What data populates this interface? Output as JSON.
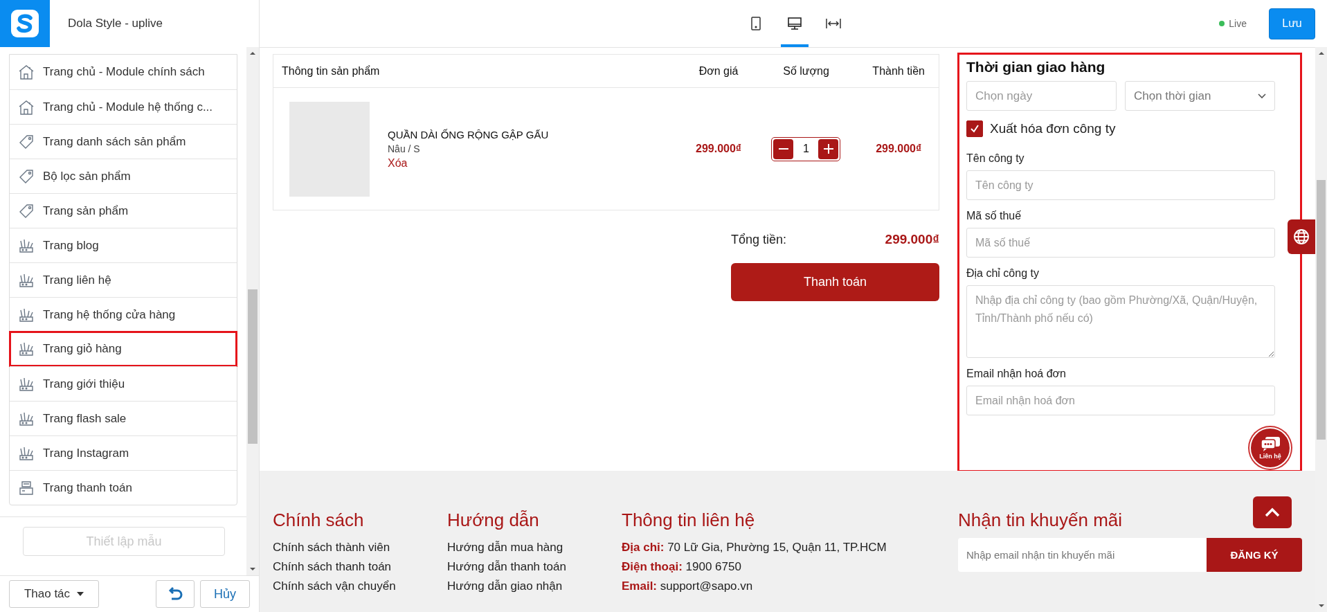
{
  "app": {
    "title": "Dola Style - uplive"
  },
  "toolbar": {
    "views": [
      {
        "kind": "mobile",
        "selected": false
      },
      {
        "kind": "desktop",
        "selected": true
      },
      {
        "kind": "fullwidth",
        "selected": false
      }
    ],
    "status": "Live",
    "save": "Lưu"
  },
  "sidebar": {
    "items": [
      {
        "kind": "home",
        "label": "Trang chủ - Module chính sách",
        "selected": false
      },
      {
        "kind": "home",
        "label": "Trang chủ - Module hệ thống c...",
        "selected": false
      },
      {
        "kind": "tag",
        "label": "Trang danh sách sản phẩm",
        "selected": false
      },
      {
        "kind": "tag",
        "label": "Bộ lọc sản phẩm",
        "selected": false
      },
      {
        "kind": "tag",
        "label": "Trang sản phẩm",
        "selected": false
      },
      {
        "kind": "tools",
        "label": "Trang blog",
        "selected": false
      },
      {
        "kind": "tools",
        "label": "Trang liên hệ",
        "selected": false
      },
      {
        "kind": "tools",
        "label": "Trang hệ thống cửa hàng",
        "selected": false
      },
      {
        "kind": "tools",
        "label": "Trang giỏ hàng",
        "selected": true
      },
      {
        "kind": "tools",
        "label": "Trang giới thiệu",
        "selected": false
      },
      {
        "kind": "tools",
        "label": "Trang flash sale",
        "selected": false
      },
      {
        "kind": "tools",
        "label": "Trang Instagram",
        "selected": false
      },
      {
        "kind": "register",
        "label": "Trang thanh toán",
        "selected": false
      }
    ],
    "template_button": {
      "label": "Thiết lập mẫu",
      "disabled": true
    }
  },
  "bottom_bar": {
    "actions": "Thao tác",
    "cancel": "Hủy"
  },
  "cart": {
    "columns": [
      "Thông tin sản phẩm",
      "Đơn giá",
      "Số lượng",
      "Thành tiền"
    ],
    "items": [
      {
        "name": "QUẦN DÀI ỐNG RỘNG GẬP GẤU",
        "variant": "Nâu / S",
        "remove": "Xóa",
        "price": "299.000₫",
        "quantity": "1",
        "total": "299.000₫"
      }
    ],
    "total_label": "Tổng tiền:",
    "total": "299.000₫",
    "checkout": "Thanh toán"
  },
  "delivery": {
    "highlighted": true,
    "title": "Thời gian giao hàng",
    "date_placeholder": "Chọn ngày",
    "time_placeholder": "Chọn thời gian",
    "invoice": {
      "label": "Xuất hóa đơn công ty",
      "checked": true
    },
    "fields": [
      {
        "kind": "input",
        "label": "Tên công ty",
        "placeholder": "Tên công ty"
      },
      {
        "kind": "input",
        "label": "Mã số thuế",
        "placeholder": "Mã số thuế"
      },
      {
        "kind": "textarea",
        "label": "Địa chỉ công ty",
        "placeholder": "Nhập địa chỉ công ty (bao gồm Phường/Xã, Quận/Huyện, Tỉnh/Thành phố nếu có)"
      },
      {
        "kind": "input",
        "label": "Email nhận hoá đơn",
        "placeholder": "Email nhận hoá đơn"
      }
    ]
  },
  "chat": {
    "label": "Liên hệ"
  },
  "footer": {
    "columns": [
      {
        "title": "Chính sách",
        "links": [
          "Chính sách thành viên",
          "Chính sách thanh toán",
          "Chính sách vận chuyển"
        ]
      },
      {
        "title": "Hướng dẫn",
        "links": [
          "Hướng dẫn mua hàng",
          "Hướng dẫn thanh toán",
          "Hướng dẫn giao nhận"
        ]
      }
    ],
    "contact": {
      "title": "Thông tin liên hệ",
      "lines": [
        {
          "label": "Địa chỉ:",
          "value": "70 Lữ Gia, Phường 15, Quận 11, TP.HCM"
        },
        {
          "label": "Điện thoại:",
          "value": "1900 6750"
        },
        {
          "label": "Email:",
          "value": "support@sapo.vn"
        }
      ]
    },
    "newsletter": {
      "title": "Nhận tin khuyến mãi",
      "placeholder": "Nhập email nhận tin khuyến mãi",
      "button": "ĐĂNG KÝ"
    }
  }
}
